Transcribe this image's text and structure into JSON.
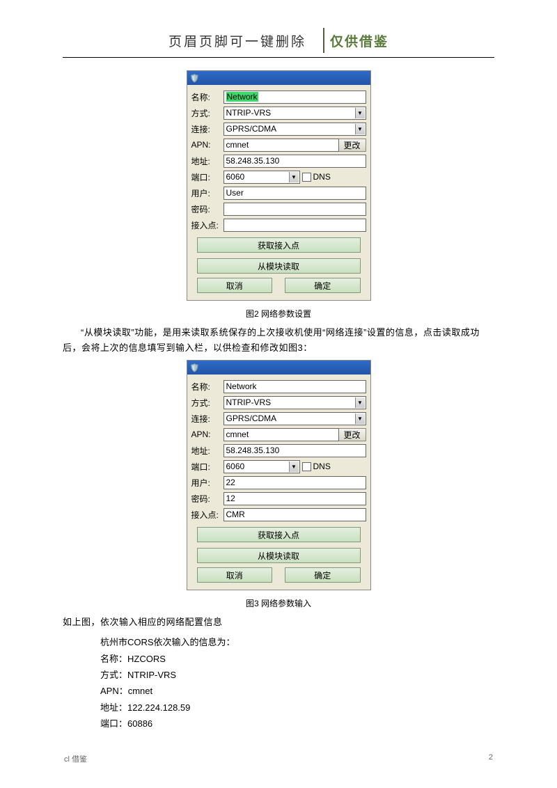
{
  "header": {
    "center": "页眉页脚可一键删除",
    "right": "仅供借鉴"
  },
  "panel1": {
    "fields": {
      "name_label": "名称:",
      "name_value": "Network",
      "method_label": "方式:",
      "method_value": "NTRIP-VRS",
      "connect_label": "连接:",
      "connect_value": "GPRS/CDMA",
      "apn_label": "APN:",
      "apn_value": "cmnet",
      "apn_change": "更改",
      "addr_label": "地址:",
      "addr_value": "58.248.35.130",
      "port_label": "端口:",
      "port_value": "6060",
      "dns_label": "DNS",
      "user_label": "用户:",
      "user_value": "User",
      "pw_label": "密码:",
      "pw_value": "",
      "ap_label": "接入点:",
      "ap_value": ""
    },
    "buttons": {
      "get_ap": "获取接入点",
      "read_module": "从模块读取",
      "cancel": "取消",
      "ok": "确定"
    }
  },
  "caption1": "图2 网络参数设置",
  "paragraph1": "“从模块读取”功能，是用来读取系统保存的上次接收机使用“网络连接”设置的信息，点击读取成功后，会将上次的信息填写到输入栏，以供检查和修改如图3：",
  "panel2": {
    "fields": {
      "name_label": "名称:",
      "name_value": "Network",
      "method_label": "方式:",
      "method_value": "NTRIP-VRS",
      "connect_label": "连接:",
      "connect_value": "GPRS/CDMA",
      "apn_label": "APN:",
      "apn_value": "cmnet",
      "apn_change": "更改",
      "addr_label": "地址:",
      "addr_value": "58.248.35.130",
      "port_label": "端口:",
      "port_value": "6060",
      "dns_label": "DNS",
      "user_label": "用户:",
      "user_value": "22",
      "pw_label": "密码:",
      "pw_value": "12",
      "ap_label": "接入点:",
      "ap_value": "CMR"
    },
    "buttons": {
      "get_ap": "获取接入点",
      "read_module": "从模块读取",
      "cancel": "取消",
      "ok": "确定"
    }
  },
  "caption2": "图3 网络参数输入",
  "paragraph2": "如上图，依次输入相应的网络配置信息",
  "info": {
    "intro": "杭州市CORS依次输入的信息为：",
    "name": "名称：HZCORS",
    "method": "方式：NTRIP-VRS",
    "apn": "APN：cmnet",
    "addr": "地址：122.224.128.59",
    "port": "端口：60886"
  },
  "footer": {
    "left": "cl 借鉴",
    "right": "2"
  }
}
